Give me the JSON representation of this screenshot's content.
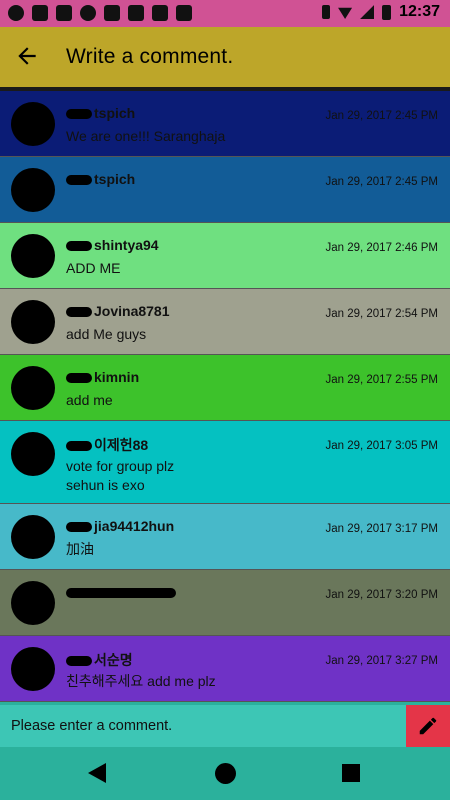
{
  "status_bar": {
    "time": "12:37"
  },
  "app_bar": {
    "title": "Write a comment."
  },
  "comments": [
    {
      "user": "tspich",
      "time": "Jan 29, 2017 2:45 PM",
      "text": "We are one!!! Saranghaja",
      "color": "#0b1c76"
    },
    {
      "user": "tspich",
      "time": "Jan 29, 2017 2:45 PM",
      "text": "",
      "color": "#125c97"
    },
    {
      "user": "shintya94",
      "time": "Jan 29, 2017 2:46 PM",
      "text": "ADD ME",
      "color": "#6fe080"
    },
    {
      "user": "Jovina8781",
      "time": "Jan 29, 2017 2:54 PM",
      "text": "add Me guys",
      "color": "#9fa18f"
    },
    {
      "user": "kimnin",
      "time": "Jan 29, 2017 2:55 PM",
      "text": "add me",
      "color": "#3dc22b"
    },
    {
      "user": "이제헌88",
      "time": "Jan 29, 2017 3:05 PM",
      "text": "vote for group plz",
      "text2": "sehun is exo",
      "color": "#05c1c1"
    },
    {
      "user": "jia94412hun",
      "time": "Jan 29, 2017 3:17 PM",
      "text": "加油",
      "color": "#47b9c9"
    },
    {
      "user": "",
      "time": "Jan 29, 2017 3:20 PM",
      "text": "",
      "color": "#6a775b"
    },
    {
      "user": "서순명",
      "time": "Jan 29, 2017 3:27 PM",
      "text": "친추해주세요 add me plz",
      "color": "#6f32c6"
    }
  ],
  "input": {
    "placeholder": "Please enter a comment."
  },
  "icons": {
    "back": "arrow-left-icon",
    "send": "pencil-icon"
  }
}
